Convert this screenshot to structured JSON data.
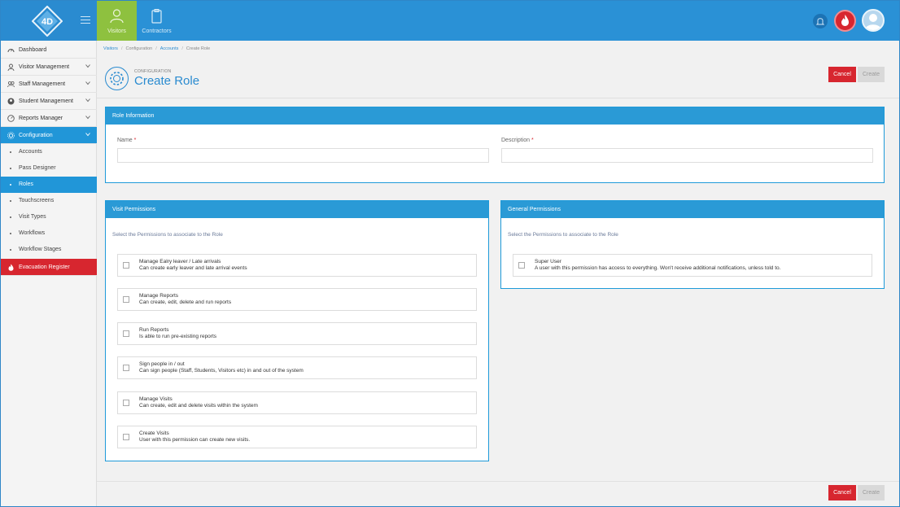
{
  "topbar": {
    "tabs": [
      {
        "label": "Visitors",
        "icon": "person-icon",
        "active": true
      },
      {
        "label": "Contractors",
        "icon": "clipboard-icon",
        "active": false
      }
    ]
  },
  "sidebar": {
    "items": [
      {
        "label": "Dashboard",
        "icon": "dashboard-icon"
      },
      {
        "label": "Visitor Management",
        "icon": "person-icon"
      },
      {
        "label": "Staff Management",
        "icon": "staff-icon"
      },
      {
        "label": "Student Management",
        "icon": "student-icon"
      },
      {
        "label": "Reports Manager",
        "icon": "reports-icon"
      },
      {
        "label": "Configuration",
        "icon": "gear-icon"
      }
    ],
    "sub_items": [
      "Accounts",
      "Pass Designer",
      "Roles",
      "Touchscreens",
      "Visit Types",
      "Workflows",
      "Workflow Stages"
    ],
    "evacuation": {
      "label": "Evacuation Register",
      "icon": "fire-icon"
    }
  },
  "breadcrumb": [
    "Visitors",
    "Configuration",
    "Accounts",
    "Create Role"
  ],
  "page": {
    "section": "CONFIGURATION",
    "title": "Create Role",
    "cancel_label": "Cancel",
    "create_label": "Create"
  },
  "role_info": {
    "header": "Role Information",
    "name_label": "Name",
    "description_label": "Description",
    "required_mark": "*"
  },
  "visit_permissions": {
    "header": "Visit Permissions",
    "hint": "Select the Permissions to associate to the Role",
    "items": [
      {
        "title": "Manage Ealry leaver / Late arrivals",
        "desc": "Can create early leaver and late arrival events"
      },
      {
        "title": "Manage Reports",
        "desc": "Can create, edit, delete and run reports"
      },
      {
        "title": "Run Reports",
        "desc": "Is able to run pre-existing reports"
      },
      {
        "title": "Sign people in / out",
        "desc": "Can sign people (Staff, Students, Visitors etc) in and out of the system"
      },
      {
        "title": "Manage Visits",
        "desc": "Can create, edit and delete visits within the system"
      },
      {
        "title": "Create Visits",
        "desc": "User with this permission can create new visits."
      }
    ]
  },
  "general_permissions": {
    "header": "General Permissions",
    "hint": "Select the Permissions to associate to the Role",
    "items": [
      {
        "title": "Super User",
        "desc": "A user with this permission has access to everything. Won't receive additional notifications, unless told to."
      }
    ]
  },
  "colors": {
    "primary": "#2a91d6",
    "accent_green": "#8ec13f",
    "danger": "#d7262f"
  }
}
